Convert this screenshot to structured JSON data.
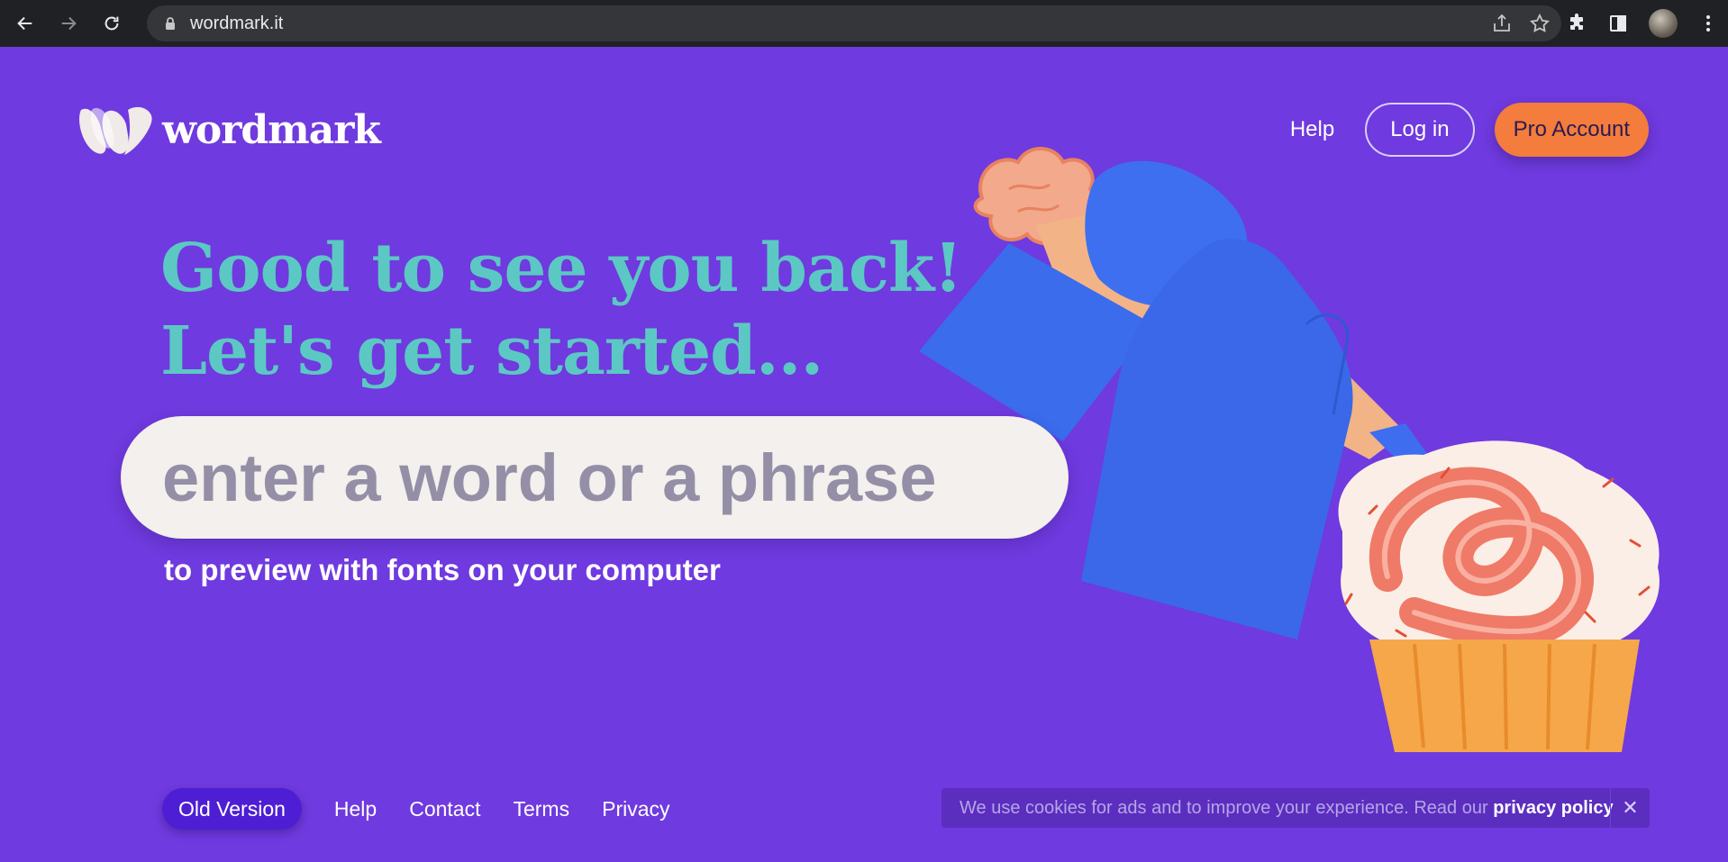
{
  "browser": {
    "url": "wordmark.it"
  },
  "header": {
    "logo_text": "wordmark",
    "nav": {
      "help": "Help",
      "login": "Log in",
      "pro": "Pro Account"
    }
  },
  "hero": {
    "headline_line1": "Good to see you back!",
    "headline_line2": "Let's get started...",
    "search_placeholder": "enter a word or a phrase",
    "subtext": "to preview with fonts on your computer"
  },
  "footer": {
    "old_version": "Old Version",
    "links": [
      "Help",
      "Contact",
      "Terms",
      "Privacy"
    ]
  },
  "cookie_banner": {
    "message": "We use cookies for ads and to improve your experience. Read our",
    "link": "privacy policy",
    "close": "✕"
  },
  "colors": {
    "background": "#6f3adf",
    "headline": "#5cc8c4",
    "pro_button": "#f47c3c",
    "old_version_button": "#4e1ed4"
  }
}
